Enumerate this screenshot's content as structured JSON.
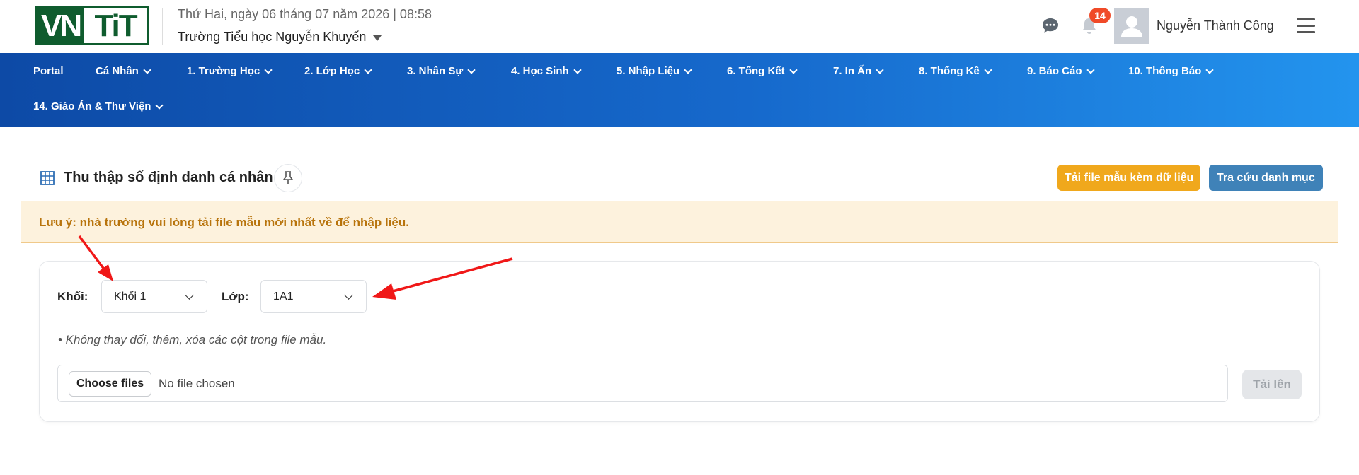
{
  "header": {
    "logo_left": "VN",
    "logo_right": "TiT",
    "date": "Thứ Hai, ngày 06 tháng 07 năm 2026 | 08:58",
    "school": "Trường Tiểu học Nguyễn Khuyến",
    "notification_count": "14",
    "user_name": "Nguyễn Thành Công"
  },
  "nav": {
    "items": [
      {
        "label": "Portal"
      },
      {
        "label": "Cá Nhân"
      },
      {
        "label": "1. Trường Học"
      },
      {
        "label": "2. Lớp Học"
      },
      {
        "label": "3. Nhân Sự"
      },
      {
        "label": "4. Học Sinh"
      },
      {
        "label": "5. Nhập Liệu"
      },
      {
        "label": "6. Tổng Kết"
      },
      {
        "label": "7. In Ấn"
      },
      {
        "label": "8. Thống Kê"
      },
      {
        "label": "9. Báo Cáo"
      },
      {
        "label": "10. Thông Báo"
      },
      {
        "label": "14. Giáo Án & Thư Viện"
      }
    ]
  },
  "page": {
    "title": "Thu thập số định danh cá nhân",
    "download_template_button": "Tải file mẫu kèm dữ liệu",
    "lookup_button": "Tra cứu danh mục"
  },
  "warning": {
    "text": "Lưu ý: nhà trường vui lòng tải file mẫu mới nhất về để nhập liệu."
  },
  "form": {
    "grade_label": "Khối:",
    "grade_value": "Khối 1",
    "class_label": "Lớp:",
    "class_value": "1A1",
    "note": "• Không thay đổi, thêm, xóa các cột trong file mẫu.",
    "choose_files": "Choose files",
    "no_file": "No file chosen",
    "upload_button": "Tải lên"
  },
  "colors": {
    "nav_gradient_start": "#0d4aa6",
    "nav_gradient_end": "#2394ee",
    "yellow_button": "#f0a81c",
    "blue_button": "#3f82b8",
    "warning_bg": "#fdf2dd",
    "warning_text": "#b8740c",
    "annotation_arrow": "#f01818"
  }
}
